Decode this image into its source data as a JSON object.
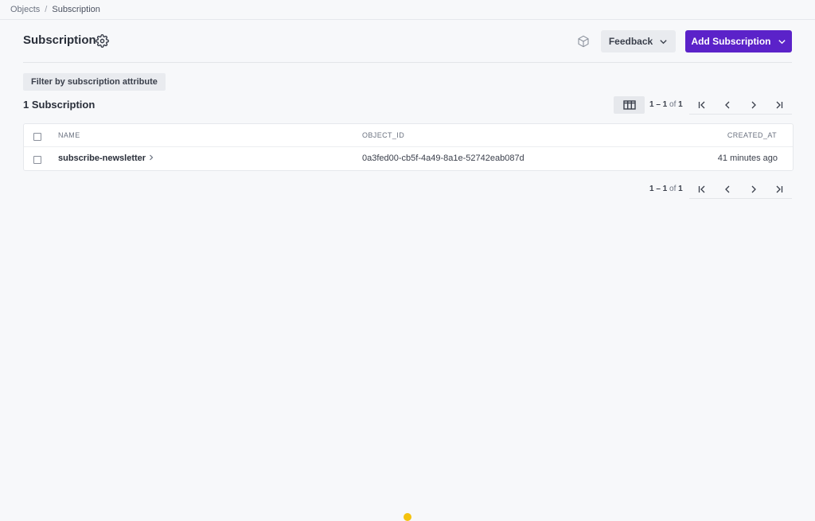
{
  "breadcrumb": {
    "root": "Objects",
    "separator": "/",
    "current": "Subscription"
  },
  "header": {
    "title": "Subscription",
    "feedback_label": "Feedback",
    "add_label": "Add Subscription"
  },
  "filter": {
    "label": "Filter by subscription attribute"
  },
  "summary": {
    "count_label": "1 Subscription"
  },
  "pagination": {
    "range": "1 – 1",
    "of": "of",
    "total": "1"
  },
  "table": {
    "columns": [
      "NAME",
      "OBJECT_ID",
      "CREATED_AT"
    ],
    "rows": [
      {
        "name": "subscribe-newsletter",
        "object_id": "0a3fed00-cb5f-4a49-8a1e-52742eab087d",
        "created_at": "41 minutes ago"
      }
    ]
  },
  "colors": {
    "accent": "#5b22c9",
    "background": "#f7f8fa"
  }
}
